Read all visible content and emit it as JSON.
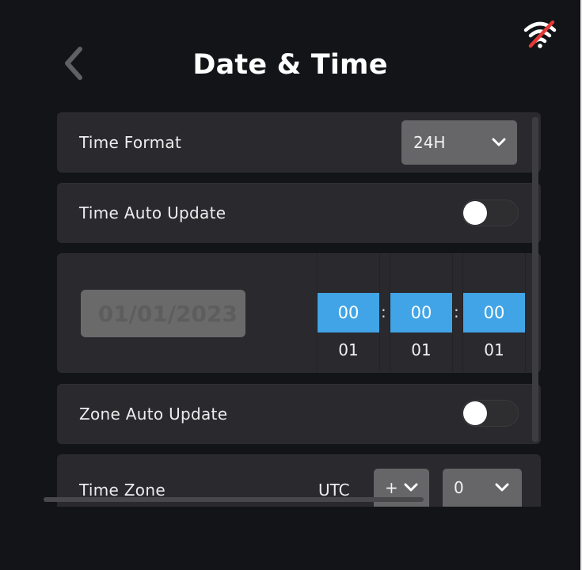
{
  "header": {
    "title": "Date & Time",
    "back_icon": "chevron-left-icon",
    "status_icon": "wifi-off-icon"
  },
  "settings": {
    "time_format": {
      "label": "Time Format",
      "value": "24H"
    },
    "time_auto_update": {
      "label": "Time Auto Update",
      "enabled": false
    },
    "date_time": {
      "date": "01/01/2023",
      "hours": {
        "selected": "00",
        "next": "01"
      },
      "minutes": {
        "selected": "00",
        "next": "01"
      },
      "seconds": {
        "selected": "00",
        "next": "01"
      },
      "separator": ":"
    },
    "zone_auto_update": {
      "label": "Zone Auto Update",
      "enabled": false
    },
    "time_zone": {
      "label": "Time Zone",
      "prefix": "UTC",
      "sign": "+",
      "offset": "0"
    }
  },
  "colors": {
    "background": "#121418",
    "card": "#2a292e",
    "accent": "#41a4e6",
    "dropdown": "#666668",
    "wifi_off_slash": "#e53935"
  }
}
